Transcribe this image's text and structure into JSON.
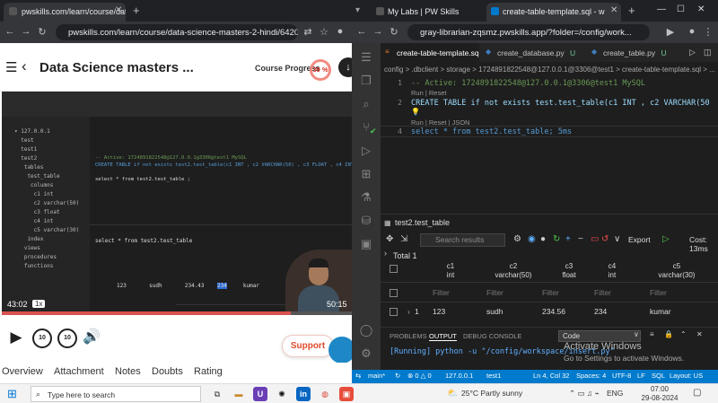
{
  "left_browser": {
    "tab_title": "pwskills.com/learn/course/data",
    "url": "pwskills.com/learn/course/data-science-masters-2-hindi/6420...",
    "course_title": "Data Science masters ...",
    "progress_label": "Course Progress",
    "progress_value": "39 %",
    "progress_fraction": 0.39,
    "video_time": "43:02",
    "video_speed": "1x",
    "video_remaining": "50:15",
    "support_label": "Support",
    "tabs": [
      "Overview",
      "Attachment",
      "Notes",
      "Doubts",
      "Rating"
    ]
  },
  "right_browser": {
    "tabs": [
      {
        "label": "My Labs | PW Skills"
      },
      {
        "label": "create-table-template.sql - w"
      }
    ],
    "url": "gray-librarian-zqsmz.pwskills.app/?folder=/config/work...",
    "editor_tabs": [
      "create-table-template.sql",
      "create_database.py",
      "create_table.py"
    ],
    "editor_tab_badges": [
      "",
      "U",
      "U"
    ],
    "breadcrumb": "config > .dbclient > storage > 1724891822548@127.0.0.1@3306@test1 > create-table-template.sql > ...",
    "code_lines": [
      {
        "num": "1",
        "text": "-- Active: 1724891822548@127.0.0.1@3306@test1  MySQL"
      },
      {
        "num": "",
        "text": "Run | Reset"
      },
      {
        "num": "2",
        "text": "CREATE TABLE if not exists test.test_table(c1 INT , c2 VARCHAR(50"
      },
      {
        "num": "",
        "text": "Run | Reset | JSON"
      },
      {
        "num": "4",
        "text": "select * from test2.test_table;  5ms"
      }
    ],
    "results_tab": "test2.test_table",
    "search_placeholder": "Search results",
    "export_label": "Export",
    "cost_label": "Cost: 13ms",
    "total_label": "Total 1",
    "columns": [
      {
        "name": "c1",
        "type": "int"
      },
      {
        "name": "c2",
        "type": "varchar(50)"
      },
      {
        "name": "c3",
        "type": "float"
      },
      {
        "name": "c4",
        "type": "int"
      },
      {
        "name": "c5",
        "type": "varchar(30)"
      }
    ],
    "filter_placeholder": "Filter",
    "rows": [
      {
        "index": "1",
        "values": [
          "123",
          "sudh",
          "234.56",
          "234",
          "kumar"
        ]
      }
    ],
    "panel_tabs": [
      "PROBLEMS",
      "OUTPUT",
      "DEBUG CONSOLE"
    ],
    "panel_select": "Code",
    "terminal_line": "[Running] python -u \"/config/workspace/insert.py\"",
    "activate_title": "Activate Windows",
    "activate_sub": "Go to Settings to activate Windows.",
    "status_items": [
      "main*",
      "127.0.0.1",
      "test1",
      "Ln 4, Col 32",
      "Spaces: 4",
      "UTF-8",
      "LF",
      "SQL",
      "Layout: US"
    ]
  },
  "taskbar": {
    "search_placeholder": "Type here to search",
    "weather": "25°C  Partly sunny",
    "time": "07:00",
    "date": "29-08-2024",
    "lang": "ENG"
  },
  "colors": {
    "vscode_blue": "#007acc",
    "keyword": "#569cd6",
    "comment": "#6a9955",
    "support_red": "#e04b2b"
  }
}
